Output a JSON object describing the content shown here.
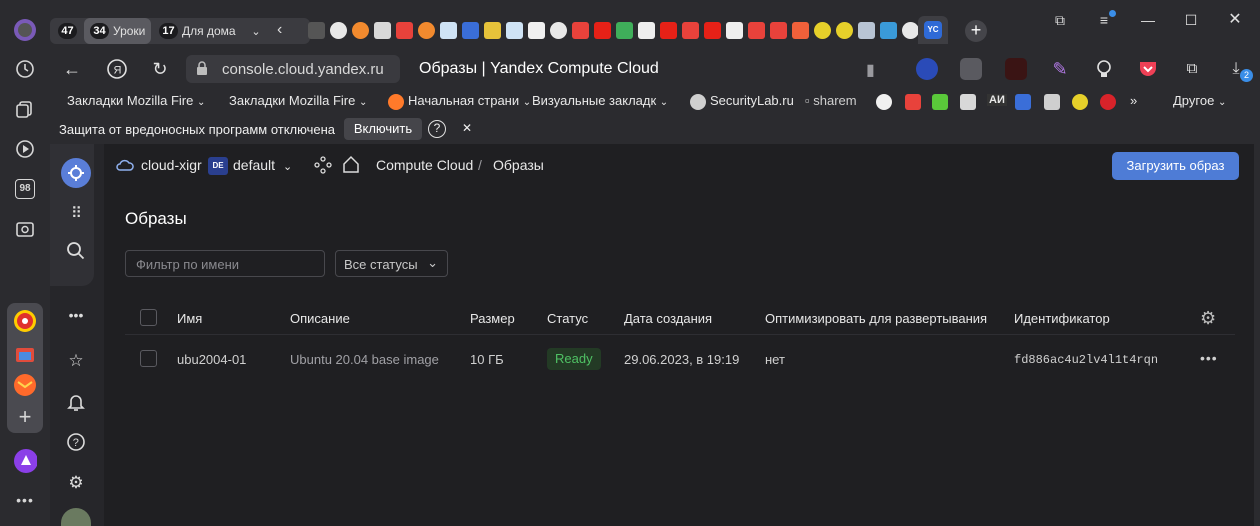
{
  "browser": {
    "tab_groups": [
      {
        "count": "47",
        "label": ""
      },
      {
        "count": "34",
        "label": "Уроки"
      },
      {
        "count": "17",
        "label": "Для дома"
      }
    ],
    "url": "console.cloud.yandex.ru",
    "page_title": "Образы | Yandex Compute Cloud",
    "downloads_badge": "2",
    "bookmarks": [
      "Закладки Mozilla Fire",
      "Закладки Mozilla Fire",
      "Начальная страни",
      "Визуальные закладк",
      "SecurityLab.ru",
      "sharem"
    ],
    "bookmark_ai": "AИ",
    "bookmarks_other": "Другое",
    "appbar_badge": "98",
    "infobar": {
      "message": "Защита от вредоносных программ отключена",
      "enable_label": "Включить",
      "help": "?",
      "close": "✕"
    }
  },
  "console": {
    "cloud": "cloud-xigr",
    "folder_badge": "DE",
    "folder": "default",
    "service": "Compute Cloud",
    "separator": "/",
    "section": "Образы",
    "upload_button": "Загрузить образ",
    "page_heading": "Образы",
    "filter_placeholder": "Фильтр по имени",
    "status_filter": "Все статусы",
    "columns": [
      "Имя",
      "Описание",
      "Размер",
      "Статус",
      "Дата создания",
      "Оптимизировать для развертывания",
      "Идентификатор"
    ],
    "rows": [
      {
        "name": "ubu2004-01",
        "description": "Ubuntu 20.04 base image",
        "size": "10 ГБ",
        "status": "Ready",
        "created": "29.06.2023, в 19:19",
        "optimize": "нет",
        "id": "fd886ac4u2lv4l1t4rqn"
      }
    ]
  },
  "colors": {
    "accent": "#4e7cd6",
    "ready": "#4fc164"
  }
}
